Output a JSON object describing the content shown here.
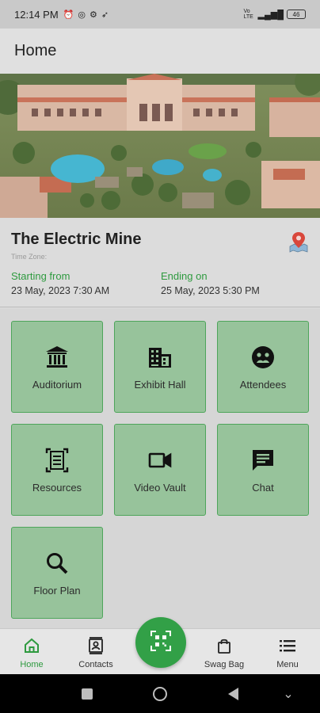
{
  "status_bar": {
    "time": "12:14 PM",
    "battery": "46",
    "network": "Vo LTE"
  },
  "header": {
    "title": "Home"
  },
  "event": {
    "title": "The Electric Mine",
    "timezone_label": "Time Zone:",
    "start_label": "Starting from",
    "start_value": "23 May, 2023   7:30 AM",
    "end_label": "Ending on",
    "end_value": "25 May, 2023   5:30 PM"
  },
  "tiles": [
    {
      "label": "Auditorium",
      "icon": "institution-icon"
    },
    {
      "label": "Exhibit Hall",
      "icon": "building-icon"
    },
    {
      "label": "Attendees",
      "icon": "people-face-icon"
    },
    {
      "label": "Resources",
      "icon": "document-scan-icon"
    },
    {
      "label": "Video Vault",
      "icon": "video-camera-icon"
    },
    {
      "label": "Chat",
      "icon": "chat-icon"
    },
    {
      "label": "Floor Plan",
      "icon": "search-icon"
    }
  ],
  "bottom_nav": [
    {
      "label": "Home",
      "icon": "home-icon",
      "active": true
    },
    {
      "label": "Contacts",
      "icon": "contacts-icon",
      "active": false
    },
    {
      "label": "Swag Bag",
      "icon": "shopping-bag-icon",
      "active": false
    },
    {
      "label": "Menu",
      "icon": "menu-icon",
      "active": false
    }
  ],
  "colors": {
    "accent": "#2e9a3f",
    "tile_bg": "#97c39b",
    "tile_border": "#4ea55b",
    "fab": "#32a047"
  }
}
